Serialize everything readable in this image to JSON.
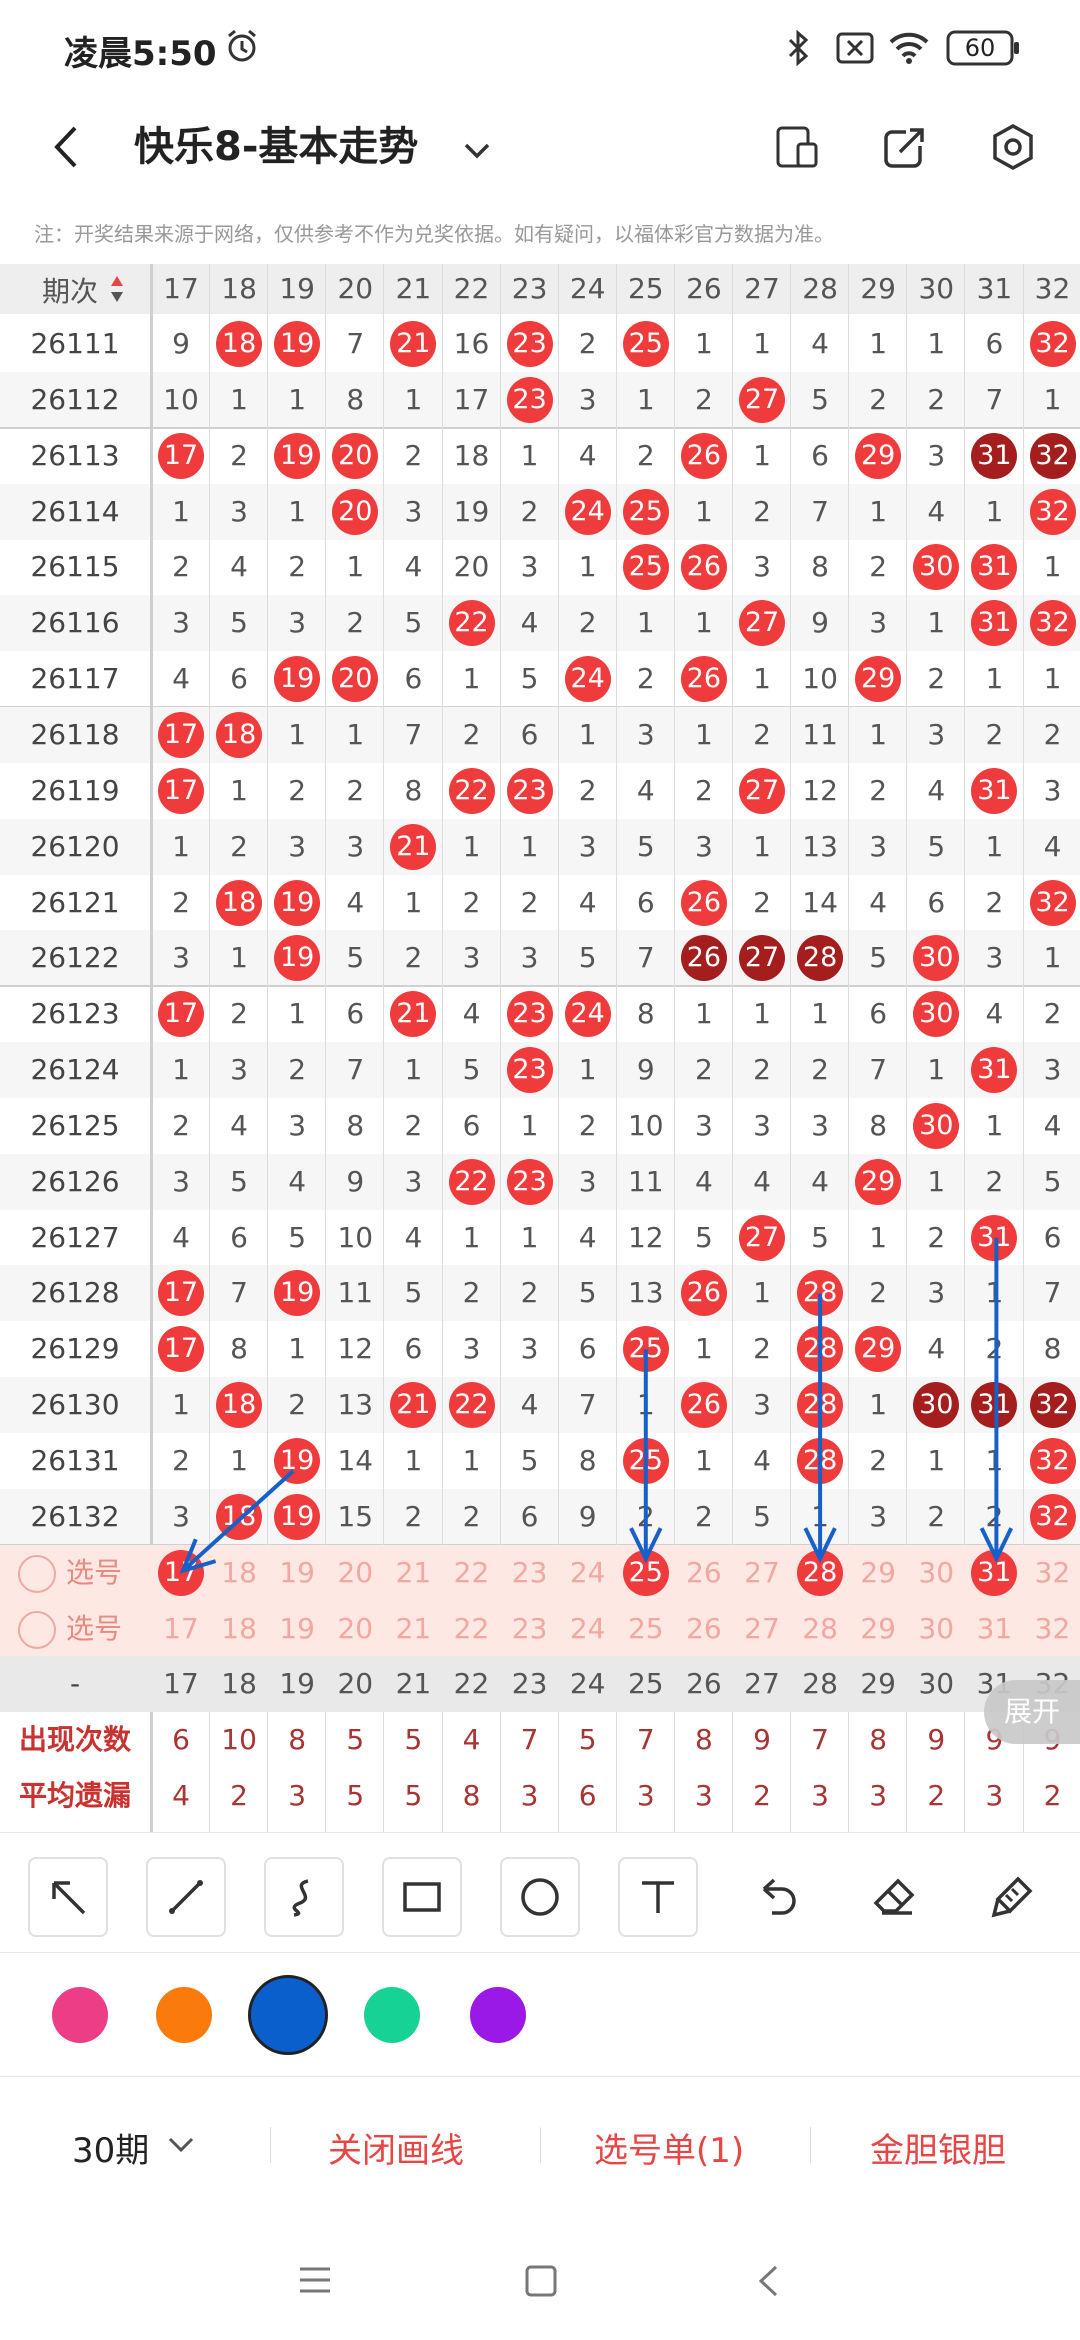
{
  "status_bar": {
    "time": "凌晨5:50",
    "battery": "60"
  },
  "header": {
    "title": "快乐8-基本走势"
  },
  "notice": "注：开奖结果来源于网络，仅供参考不作为兑奖依据。如有疑问，以福体彩官方数据为准。",
  "table": {
    "issue_header": "期次",
    "columns": [
      "17",
      "18",
      "19",
      "20",
      "21",
      "22",
      "23",
      "24",
      "25",
      "26",
      "27",
      "28",
      "29",
      "30",
      "31",
      "32"
    ],
    "rows": [
      {
        "issue": "26111",
        "cells": [
          "9",
          "18*",
          "19*",
          "7",
          "21*",
          "16",
          "23*",
          "2",
          "25*",
          "1",
          "1",
          "4",
          "1",
          "1",
          "6",
          "32*"
        ]
      },
      {
        "issue": "26112",
        "cells": [
          "10",
          "1",
          "1",
          "8",
          "1",
          "17",
          "23*",
          "3",
          "1",
          "2",
          "27*",
          "5",
          "2",
          "2",
          "7",
          "1"
        ]
      },
      {
        "issue": "26113",
        "cells": [
          "17*",
          "2",
          "19*",
          "20*",
          "2",
          "18",
          "1",
          "4",
          "2",
          "26*",
          "1",
          "6",
          "29*",
          "3",
          "31D",
          "32D"
        ]
      },
      {
        "issue": "26114",
        "cells": [
          "1",
          "3",
          "1",
          "20*",
          "3",
          "19",
          "2",
          "24*",
          "25*",
          "1",
          "2",
          "7",
          "1",
          "4",
          "1",
          "32*"
        ]
      },
      {
        "issue": "26115",
        "cells": [
          "2",
          "4",
          "2",
          "1",
          "4",
          "20",
          "3",
          "1",
          "25*",
          "26*",
          "3",
          "8",
          "2",
          "30*",
          "31*",
          "1"
        ]
      },
      {
        "issue": "26116",
        "cells": [
          "3",
          "5",
          "3",
          "2",
          "5",
          "22*",
          "4",
          "2",
          "1",
          "1",
          "27*",
          "9",
          "3",
          "1",
          "31*",
          "32*"
        ]
      },
      {
        "issue": "26117",
        "cells": [
          "4",
          "6",
          "19*",
          "20*",
          "6",
          "1",
          "5",
          "24*",
          "2",
          "26*",
          "1",
          "10",
          "29*",
          "2",
          "1",
          "1"
        ]
      },
      {
        "issue": "26118",
        "cells": [
          "17*",
          "18*",
          "1",
          "1",
          "7",
          "2",
          "6",
          "1",
          "3",
          "1",
          "2",
          "11",
          "1",
          "3",
          "2",
          "2"
        ]
      },
      {
        "issue": "26119",
        "cells": [
          "17*",
          "1",
          "2",
          "2",
          "8",
          "22*",
          "23*",
          "2",
          "4",
          "2",
          "27*",
          "12",
          "2",
          "4",
          "31*",
          "3"
        ]
      },
      {
        "issue": "26120",
        "cells": [
          "1",
          "2",
          "3",
          "3",
          "21*",
          "1",
          "1",
          "3",
          "5",
          "3",
          "1",
          "13",
          "3",
          "5",
          "1",
          "4"
        ]
      },
      {
        "issue": "26121",
        "cells": [
          "2",
          "18*",
          "19*",
          "4",
          "1",
          "2",
          "2",
          "4",
          "6",
          "26*",
          "2",
          "14",
          "4",
          "6",
          "2",
          "32*"
        ]
      },
      {
        "issue": "26122",
        "cells": [
          "3",
          "1",
          "19*",
          "5",
          "2",
          "3",
          "3",
          "5",
          "7",
          "26D",
          "27D",
          "28D",
          "5",
          "30*",
          "3",
          "1"
        ]
      },
      {
        "issue": "26123",
        "cells": [
          "17*",
          "2",
          "1",
          "6",
          "21*",
          "4",
          "23*",
          "24*",
          "8",
          "1",
          "1",
          "1",
          "6",
          "30*",
          "4",
          "2"
        ]
      },
      {
        "issue": "26124",
        "cells": [
          "1",
          "3",
          "2",
          "7",
          "1",
          "5",
          "23*",
          "1",
          "9",
          "2",
          "2",
          "2",
          "7",
          "1",
          "31*",
          "3"
        ]
      },
      {
        "issue": "26125",
        "cells": [
          "2",
          "4",
          "3",
          "8",
          "2",
          "6",
          "1",
          "2",
          "10",
          "3",
          "3",
          "3",
          "8",
          "30*",
          "1",
          "4"
        ]
      },
      {
        "issue": "26126",
        "cells": [
          "3",
          "5",
          "4",
          "9",
          "3",
          "22*",
          "23*",
          "3",
          "11",
          "4",
          "4",
          "4",
          "29*",
          "1",
          "2",
          "5"
        ]
      },
      {
        "issue": "26127",
        "cells": [
          "4",
          "6",
          "5",
          "10",
          "4",
          "1",
          "1",
          "4",
          "12",
          "5",
          "27*",
          "5",
          "1",
          "2",
          "31*",
          "6"
        ]
      },
      {
        "issue": "26128",
        "cells": [
          "17*",
          "7",
          "19*",
          "11",
          "5",
          "2",
          "2",
          "5",
          "13",
          "26*",
          "1",
          "28*",
          "2",
          "3",
          "1",
          "7"
        ]
      },
      {
        "issue": "26129",
        "cells": [
          "17*",
          "8",
          "1",
          "12",
          "6",
          "3",
          "3",
          "6",
          "25*",
          "1",
          "2",
          "28*",
          "29*",
          "4",
          "2",
          "8"
        ]
      },
      {
        "issue": "26130",
        "cells": [
          "1",
          "18*",
          "2",
          "13",
          "21*",
          "22*",
          "4",
          "7",
          "1",
          "26*",
          "3",
          "28*",
          "1",
          "30D",
          "31D",
          "32D"
        ]
      },
      {
        "issue": "26131",
        "cells": [
          "2",
          "1",
          "19*",
          "14",
          "1",
          "1",
          "5",
          "8",
          "25*",
          "1",
          "4",
          "28*",
          "2",
          "1",
          "1",
          "32*"
        ]
      },
      {
        "issue": "26132",
        "cells": [
          "3",
          "18*",
          "19*",
          "15",
          "2",
          "2",
          "6",
          "9",
          "2",
          "2",
          "5",
          "1",
          "3",
          "2",
          "2",
          "32*"
        ]
      }
    ],
    "select_rows": [
      {
        "label": "选号",
        "selected": [
          "17",
          "25",
          "28",
          "31"
        ]
      },
      {
        "label": "选号",
        "selected": []
      }
    ],
    "footer_dash": "-",
    "stats": [
      {
        "label": "出现次数",
        "values": [
          "6",
          "10",
          "8",
          "5",
          "5",
          "4",
          "7",
          "5",
          "7",
          "8",
          "9",
          "7",
          "8",
          "9",
          "9",
          "9"
        ]
      },
      {
        "label": "平均遗漏",
        "values": [
          "4",
          "2",
          "3",
          "5",
          "5",
          "8",
          "3",
          "6",
          "3",
          "3",
          "2",
          "3",
          "3",
          "2",
          "3",
          "2"
        ]
      }
    ],
    "expand_label": "展开"
  },
  "colors": {
    "accent": "#e84545",
    "ball": "#ef3b3b",
    "ball_dark": "#a41e1e",
    "arrow": "#1560c9"
  },
  "tools": [
    "arrow-tool-icon",
    "line-tool-icon",
    "curve-tool-icon",
    "rectangle-tool-icon",
    "circle-tool-icon",
    "text-tool-icon",
    "undo-icon",
    "eraser-icon",
    "clear-icon"
  ],
  "palette": [
    "#ee3d87",
    "#fb7a0c",
    "#0b5fcc",
    "#16d295",
    "#9b19e6"
  ],
  "bottom_bar": {
    "period": "30期",
    "close_draw": "关闭画线",
    "selection_list": "选号单(1)",
    "gold_silver": "金胆银胆"
  }
}
